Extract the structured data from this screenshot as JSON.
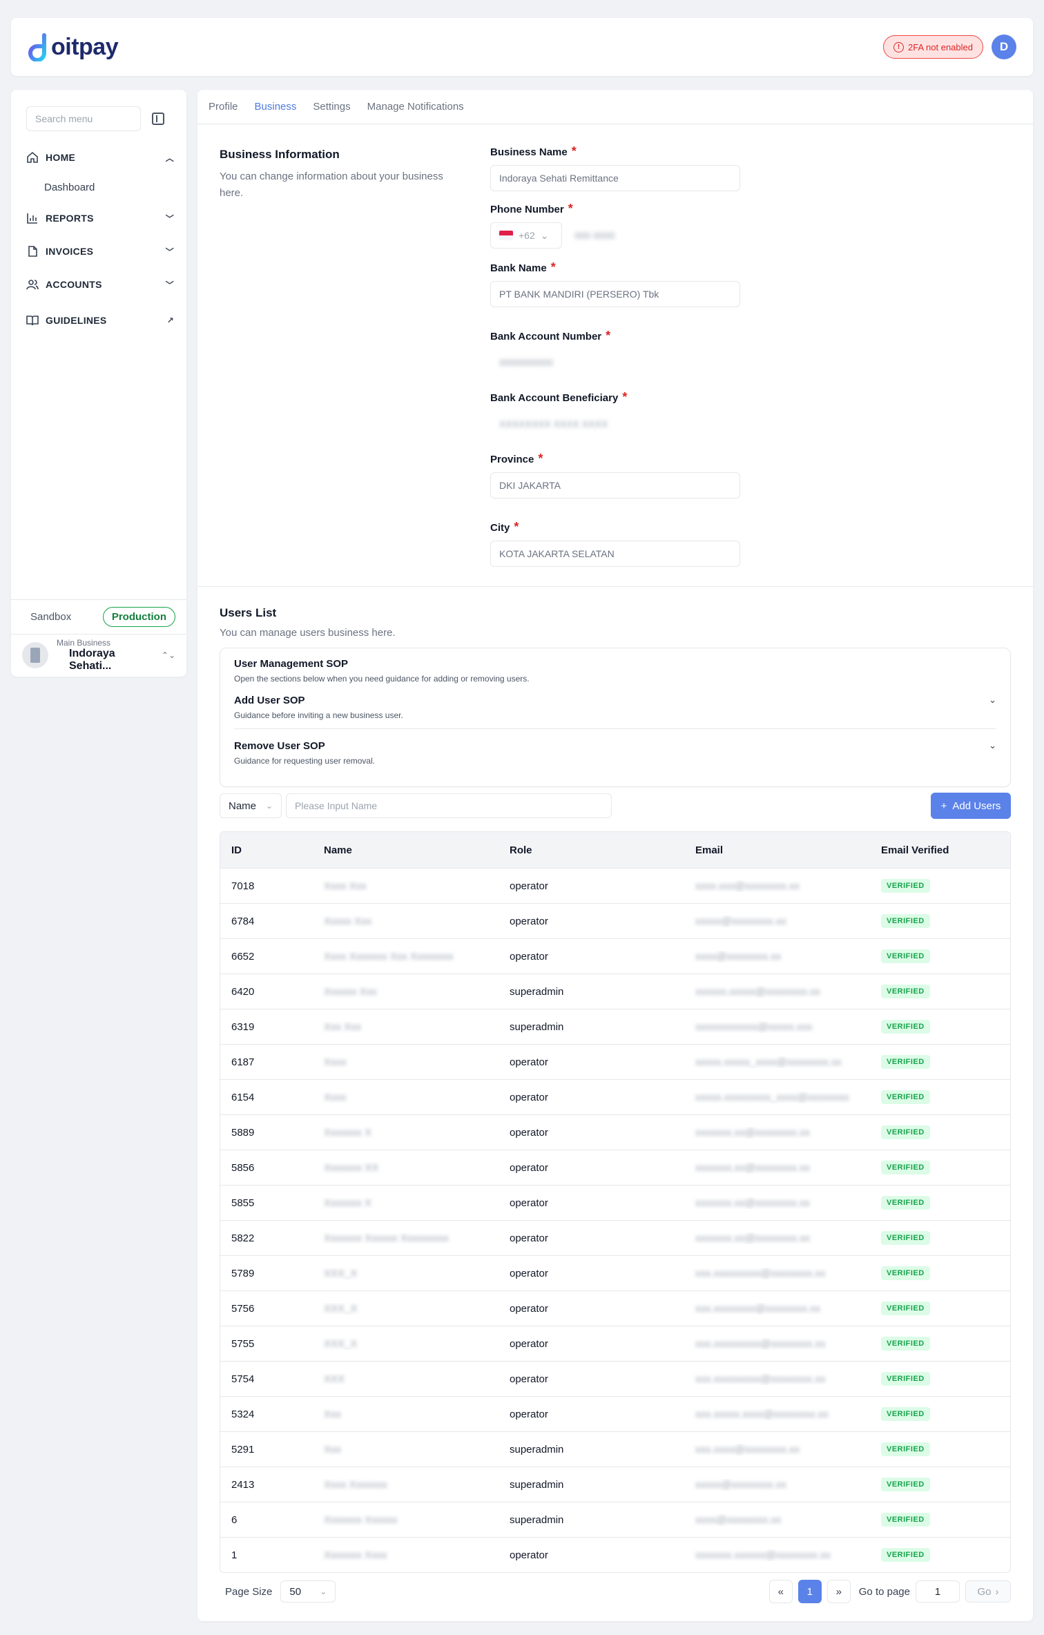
{
  "header": {
    "logo_text": "oitpay",
    "twofa_label": "2FA not enabled",
    "avatar_initial": "D",
    "accent": "#5b82e8",
    "warning_color": "#dc2626"
  },
  "sidebar": {
    "search_placeholder": "Search menu",
    "items": [
      {
        "label": "HOME",
        "icon": "home-icon",
        "chevron": "chevron-up"
      },
      {
        "label": "Dashboard"
      },
      {
        "label": "REPORTS",
        "icon": "bar-chart-icon",
        "chevron": "chevron-down"
      },
      {
        "label": "INVOICES",
        "icon": "document-icon",
        "chevron": "chevron-down"
      },
      {
        "label": "ACCOUNTS",
        "icon": "users-icon",
        "chevron": "chevron-down"
      },
      {
        "label": "GUIDELINES",
        "icon": "book-icon",
        "chevron": "external-arrow"
      }
    ],
    "env_sandbox": "Sandbox",
    "env_production": "Production",
    "business_label": "Main Business",
    "business_name": "Indoraya Sehati..."
  },
  "tabs": [
    "Profile",
    "Business",
    "Settings",
    "Manage Notifications"
  ],
  "active_tab": "Business",
  "business_info": {
    "title": "Business Information",
    "description": "You can change information about your business here.",
    "fields": {
      "business_name_label": "Business Name",
      "business_name_value": "Indoraya Sehati Remittance",
      "phone_label": "Phone Number",
      "phone_code": "+62",
      "phone_value": "000 0000",
      "bank_name_label": "Bank Name",
      "bank_name_value": "PT BANK MANDIRI (PERSERO) Tbk",
      "bank_account_label": "Bank Account Number",
      "bank_account_value": "0000000000",
      "beneficiary_label": "Bank Account Beneficiary",
      "beneficiary_value": "XXXXXXXX XXXX XXXX",
      "province_label": "Province",
      "province_value": "DKI JAKARTA",
      "city_label": "City",
      "city_value": "KOTA JAKARTA SELATAN"
    }
  },
  "users": {
    "title": "Users List",
    "description": "You can manage users business here.",
    "sop": {
      "title": "User Management SOP",
      "subtitle": "Open the sections below when you need guidance for adding or removing users.",
      "items": [
        {
          "title": "Add User SOP",
          "subtitle": "Guidance before inviting a new business user."
        },
        {
          "title": "Remove User SOP",
          "subtitle": "Guidance for requesting user removal."
        }
      ]
    },
    "filter_field": "Name",
    "filter_placeholder": "Please Input Name",
    "add_button": "Add Users",
    "columns": [
      "ID",
      "Name",
      "Role",
      "Email",
      "Email Verified"
    ],
    "rows": [
      {
        "id": "7018",
        "name": "Xxxx Xxx",
        "role": "operator",
        "email": "xxxx.xxx@xxxxxxxx.xx",
        "verified": "VERIFIED"
      },
      {
        "id": "6784",
        "name": "Xxxxx Xxx",
        "role": "operator",
        "email": "xxxxx@xxxxxxxx.xx",
        "verified": "VERIFIED"
      },
      {
        "id": "6652",
        "name": "Xxxx Xxxxxxx Xxx Xxxxxxxx",
        "role": "operator",
        "email": "xxxx@xxxxxxxx.xx",
        "verified": "VERIFIED"
      },
      {
        "id": "6420",
        "name": "Xxxxxx Xxx",
        "role": "superadmin",
        "email": "xxxxxx.xxxxx@xxxxxxxx.xx",
        "verified": "VERIFIED"
      },
      {
        "id": "6319",
        "name": "Xxx Xxx",
        "role": "superadmin",
        "email": "xxxxxxxxxxxx@xxxxx.xxx",
        "verified": "VERIFIED"
      },
      {
        "id": "6187",
        "name": "Xxxx",
        "role": "operator",
        "email": "xxxxx.xxxxx_xxxx@xxxxxxxx.xx",
        "verified": "VERIFIED"
      },
      {
        "id": "6154",
        "name": "Xxxx",
        "role": "operator",
        "email": "xxxxx.xxxxxxxxx_xxxx@xxxxxxxx",
        "verified": "VERIFIED"
      },
      {
        "id": "5889",
        "name": "Xxxxxxx X",
        "role": "operator",
        "email": "xxxxxxx.xx@xxxxxxxx.xx",
        "verified": "VERIFIED"
      },
      {
        "id": "5856",
        "name": "Xxxxxxx XX",
        "role": "operator",
        "email": "xxxxxxx.xx@xxxxxxxx.xx",
        "verified": "VERIFIED"
      },
      {
        "id": "5855",
        "name": "Xxxxxxx X",
        "role": "operator",
        "email": "xxxxxxx.xx@xxxxxxxx.xx",
        "verified": "VERIFIED"
      },
      {
        "id": "5822",
        "name": "Xxxxxxx Xxxxxx Xxxxxxxxx",
        "role": "operator",
        "email": "xxxxxxx.xx@xxxxxxxx.xx",
        "verified": "VERIFIED"
      },
      {
        "id": "5789",
        "name": "XXX_X",
        "role": "operator",
        "email": "xxx.xxxxxxxxx@xxxxxxxx.xx",
        "verified": "VERIFIED"
      },
      {
        "id": "5756",
        "name": "XXX_X",
        "role": "operator",
        "email": "xxx.xxxxxxxx@xxxxxxxx.xx",
        "verified": "VERIFIED"
      },
      {
        "id": "5755",
        "name": "XXX_X",
        "role": "operator",
        "email": "xxx.xxxxxxxxx@xxxxxxxx.xx",
        "verified": "VERIFIED"
      },
      {
        "id": "5754",
        "name": "XXX",
        "role": "operator",
        "email": "xxx.xxxxxxxxx@xxxxxxxx.xx",
        "verified": "VERIFIED"
      },
      {
        "id": "5324",
        "name": "Xxx",
        "role": "operator",
        "email": "xxx.xxxxx.xxxx@xxxxxxxx.xx",
        "verified": "VERIFIED"
      },
      {
        "id": "5291",
        "name": "Xxx",
        "role": "superadmin",
        "email": "xxx.xxxx@xxxxxxxx.xx",
        "verified": "VERIFIED"
      },
      {
        "id": "2413",
        "name": "Xxxx Xxxxxxx",
        "role": "superadmin",
        "email": "xxxxx@xxxxxxxx.xx",
        "verified": "VERIFIED"
      },
      {
        "id": "6",
        "name": "Xxxxxxx Xxxxxx",
        "role": "superadmin",
        "email": "xxxx@xxxxxxxx.xx",
        "verified": "VERIFIED"
      },
      {
        "id": "1",
        "name": "Xxxxxxx Xxxx",
        "role": "operator",
        "email": "xxxxxxx.xxxxxx@xxxxxxxx.xx",
        "verified": "VERIFIED"
      }
    ],
    "pagination": {
      "page_size_label": "Page Size",
      "page_size": "50",
      "current_page": "1",
      "goto_label": "Go to page",
      "goto_value": "1",
      "go_button": "Go"
    }
  }
}
